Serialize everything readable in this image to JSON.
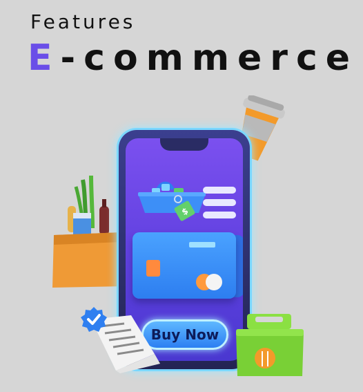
{
  "header": {
    "subtitle": "Features",
    "title_first_letter": "E",
    "title_rest": "-commerce"
  },
  "phone_screen": {
    "buy_button_label": "Buy Now"
  },
  "icons": [
    "coffee-cup-icon",
    "grocery-bag-icon",
    "shopping-basket-icon",
    "price-tag-icon",
    "menu-lines-icon",
    "credit-card-icon",
    "verified-badge-icon",
    "receipt-icon",
    "food-box-icon"
  ],
  "colors": {
    "background": "#d6d6d6",
    "accent_letter": "#6a4ee8",
    "screen": "#6a45e8",
    "card": "#3a8cf7",
    "button": "#3d94ff",
    "bag": "#e8952f",
    "food_box": "#7fd43a"
  }
}
